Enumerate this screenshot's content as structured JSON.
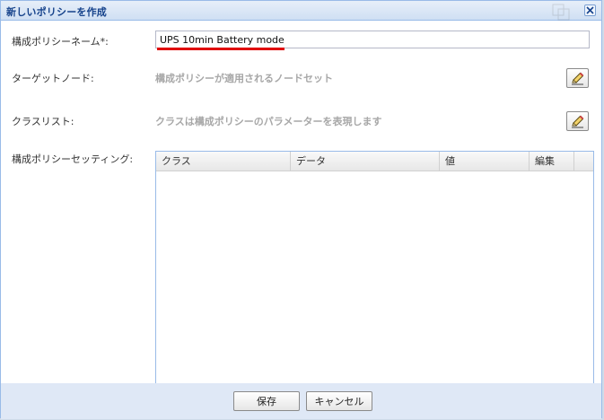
{
  "dialog": {
    "title": "新しいポリシーを作成",
    "close_icon": "close-icon",
    "accent_color": "#15428b",
    "underline_color": "#e00000"
  },
  "form": {
    "name_label": "構成ポリシーネーム*:",
    "name_value": "UPS 10min Battery mode",
    "target_label": "ターゲットノード:",
    "target_hint": "構成ポリシーが適用されるノードセット",
    "class_label": "クラスリスト:",
    "class_hint": "クラスは構成ポリシーのパラメーターを表現します",
    "settings_label": "構成ポリシーセッティング:",
    "edit_icon": "pencil-icon"
  },
  "grid": {
    "columns": [
      "クラス",
      "データ",
      "値",
      "編集"
    ]
  },
  "footer": {
    "save_label": "保存",
    "cancel_label": "キャンセル"
  }
}
